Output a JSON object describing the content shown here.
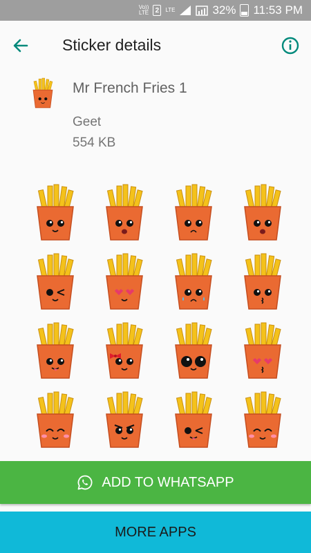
{
  "status_bar": {
    "volte_label": "Vo))\nLTE",
    "sim_label": "2",
    "lte_label": "LTE",
    "battery_text": "32%",
    "time": "11:53 PM"
  },
  "app_bar": {
    "title": "Sticker details",
    "back_icon": "arrow-back-icon",
    "info_icon": "info-icon",
    "accent_color": "#00897b"
  },
  "pack": {
    "name": "Mr French Fries 1",
    "publisher": "Geet",
    "size": "554 KB"
  },
  "stickers": [
    {
      "expression": "big-eyes"
    },
    {
      "expression": "scared"
    },
    {
      "expression": "sad"
    },
    {
      "expression": "surprised"
    },
    {
      "expression": "wink"
    },
    {
      "expression": "heart-eyes"
    },
    {
      "expression": "crying"
    },
    {
      "expression": "kiss"
    },
    {
      "expression": "tongue-out"
    },
    {
      "expression": "bow"
    },
    {
      "expression": "dark-eyes"
    },
    {
      "expression": "love-kiss"
    },
    {
      "expression": "blush"
    },
    {
      "expression": "angry"
    },
    {
      "expression": "tongue-wink"
    },
    {
      "expression": "happy-blush"
    }
  ],
  "actions": {
    "add_label": "ADD TO WHATSAPP",
    "more_label": "MORE APPS",
    "add_color": "#4bb543",
    "more_color": "#10b9d8"
  }
}
